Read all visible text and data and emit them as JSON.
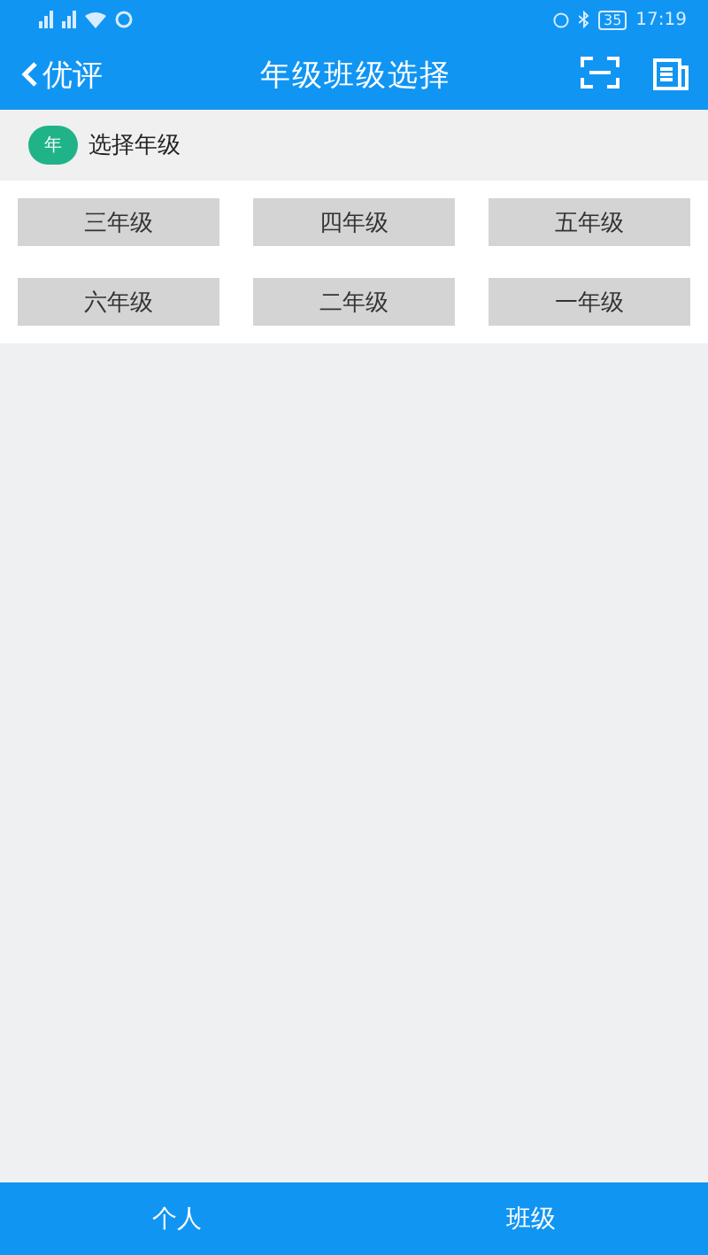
{
  "status_bar": {
    "battery": "35",
    "time": "17:19"
  },
  "header": {
    "back_label": "优评",
    "title": "年级班级选择"
  },
  "section": {
    "badge": "年",
    "title": "选择年级"
  },
  "grades": [
    {
      "label": "三年级"
    },
    {
      "label": "四年级"
    },
    {
      "label": "五年级"
    },
    {
      "label": "六年级"
    },
    {
      "label": "二年级"
    },
    {
      "label": "一年级"
    }
  ],
  "bottom_tabs": [
    {
      "label": "个人"
    },
    {
      "label": "班级"
    }
  ]
}
